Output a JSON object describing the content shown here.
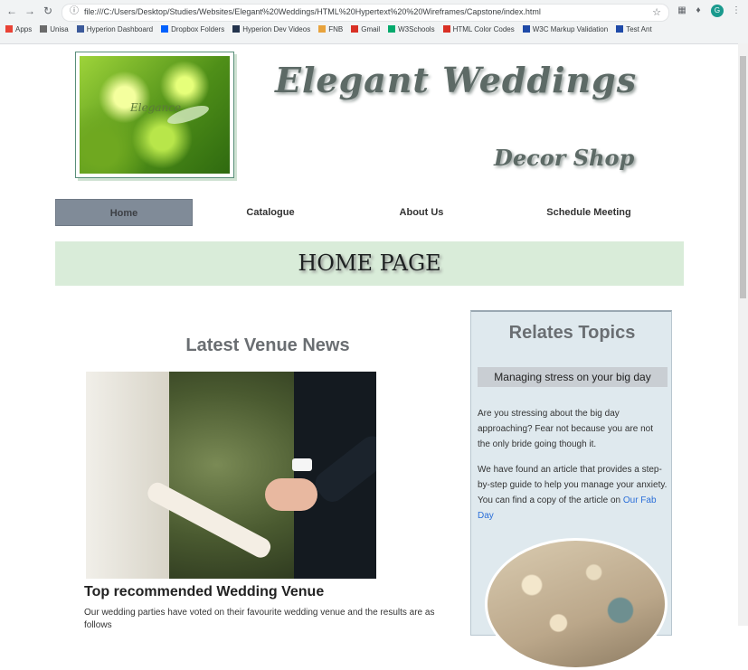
{
  "browser": {
    "url": "file:///C:/Users/Desktop/Studies/Websites/Elegant%20Weddings/HTML%20Hypertext%20%20Wireframes/Capstone/index.html",
    "bookmarks": [
      {
        "label": "Apps",
        "icon": "apps-grid-icon",
        "color": "#e94235"
      },
      {
        "label": "Unisa",
        "icon": "bookmark-icon",
        "color": "#6b6b6b"
      },
      {
        "label": "Hyperion Dashboard",
        "icon": "bookmark-icon",
        "color": "#3c5a9a"
      },
      {
        "label": "Dropbox Folders",
        "icon": "dropbox-icon",
        "color": "#0061fe"
      },
      {
        "label": "Hyperion Dev Videos",
        "icon": "bookmark-icon",
        "color": "#24344d"
      },
      {
        "label": "FNB",
        "icon": "fnb-icon",
        "color": "#e8a33c"
      },
      {
        "label": "Gmail",
        "icon": "gmail-icon",
        "color": "#d93025"
      },
      {
        "label": "W3Schools",
        "icon": "w3schools-icon",
        "color": "#04aa6d"
      },
      {
        "label": "HTML Color Codes",
        "icon": "bookmark-icon",
        "color": "#d93025"
      },
      {
        "label": "W3C Markup Validation",
        "icon": "w3c-icon",
        "color": "#1f4aa8"
      },
      {
        "label": "Test Ant",
        "icon": "bookmark-icon",
        "color": "#1f4aa8"
      }
    ]
  },
  "site": {
    "title": "Elegant Weddings",
    "subtitle": "Decor Shop",
    "logo_text": "Elegance"
  },
  "nav": {
    "items": [
      {
        "label": "Home"
      },
      {
        "label": "Catalogue"
      },
      {
        "label": "About Us"
      },
      {
        "label": "Schedule Meeting"
      }
    ]
  },
  "banner": {
    "title": "HOME PAGE"
  },
  "news": {
    "heading": "Latest Venue News",
    "article_title": "Top recommended Wedding Venue",
    "article_text": "Our wedding parties have voted on their favourite wedding venue and the results are as follows"
  },
  "sidebar": {
    "heading": "Relates Topics",
    "subheading": "Managing stress on your big day",
    "paragraph1": "Are you stressing about the big day approaching? Fear not because you are not the only bride going though it.",
    "paragraph2": "We have found an article that provides a step-by-step guide to help you manage your anxiety. You can find a copy of the article on",
    "link": "Our Fab Day"
  }
}
